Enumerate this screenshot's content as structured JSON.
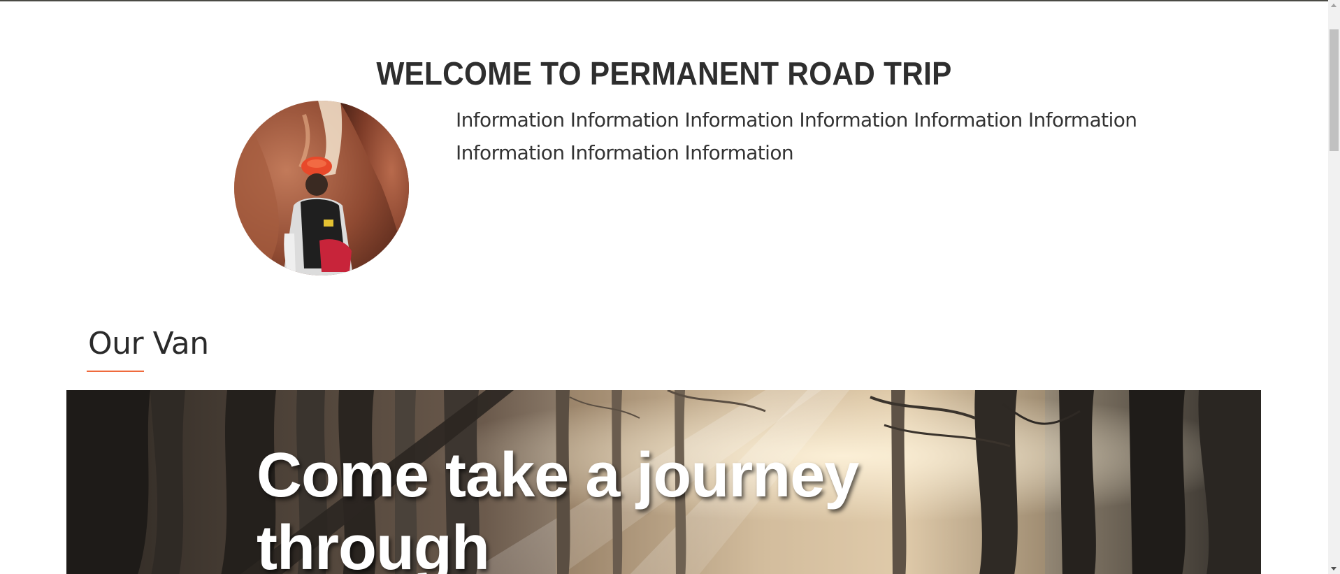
{
  "header": {
    "title": "WELCOME TO PERMANENT ROAD TRIP"
  },
  "intro": {
    "avatar_icon": "hiker-in-canyon-photo",
    "text": "Information Information Information Information Information Information Information Information Information"
  },
  "van_section": {
    "title": "Our Van",
    "accent_color": "#ef6a3d"
  },
  "hero": {
    "image_icon": "forest-trees-sunlight-photo",
    "heading": "Come take a journey through"
  }
}
